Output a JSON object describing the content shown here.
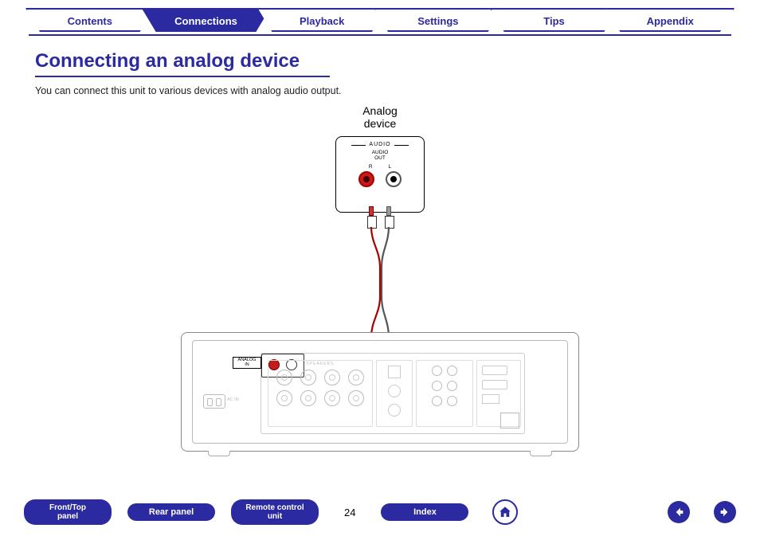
{
  "tabs": [
    {
      "label": "Contents",
      "key": "contents"
    },
    {
      "label": "Connections",
      "key": "connections"
    },
    {
      "label": "Playback",
      "key": "playback"
    },
    {
      "label": "Settings",
      "key": "settings"
    },
    {
      "label": "Tips",
      "key": "tips"
    },
    {
      "label": "Appendix",
      "key": "appendix"
    }
  ],
  "active_tab": "Connections",
  "heading": "Connecting an analog device",
  "lead": "You can connect this unit to various devices with analog audio output.",
  "diagram": {
    "source_label": "Analog\ndevice",
    "audio_caption": "AUDIO",
    "audio_out": "AUDIO\nOUT",
    "r_label": "R",
    "l_label": "L",
    "analog_in_label": "ANALOG\nIN",
    "speakers_label": "SPEAKERS",
    "ac_in_label": "AC IN"
  },
  "footer": {
    "buttons": [
      {
        "label": "Front/Top\npanel",
        "key": "front-top-panel"
      },
      {
        "label": "Rear panel",
        "key": "rear-panel"
      },
      {
        "label": "Remote control\nunit",
        "key": "remote-control-unit"
      },
      {
        "label": "Index",
        "key": "index"
      }
    ],
    "page_number": "24"
  }
}
